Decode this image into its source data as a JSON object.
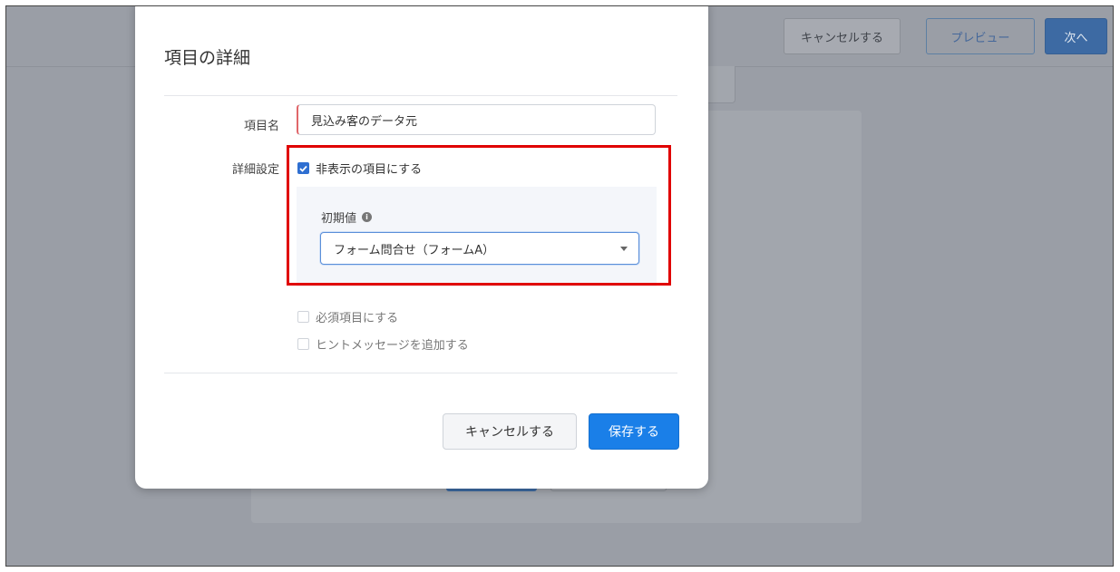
{
  "background": {
    "header_buttons": {
      "cancel": "キャンセルする",
      "preview": "プレビュー",
      "next": "次へ"
    }
  },
  "modal": {
    "title": "項目の詳細",
    "fields": {
      "name_label": "項目名",
      "name_value": "見込み客のデータ元",
      "detail_label": "詳細設定"
    },
    "options": {
      "hidden_label": "非表示の項目にする",
      "hidden_checked": true,
      "required_label": "必須項目にする",
      "required_checked": false,
      "hint_label": "ヒントメッセージを追加する",
      "hint_checked": false
    },
    "initial_value": {
      "label": "初期値",
      "info_icon": "info-icon",
      "selected": "フォーム問合せ（フォームA）"
    },
    "buttons": {
      "cancel": "キャンセルする",
      "save": "保存する"
    }
  },
  "colors": {
    "primary": "#1a7fe8",
    "highlight": "#e00000",
    "overlay": "#9a9ea6"
  }
}
